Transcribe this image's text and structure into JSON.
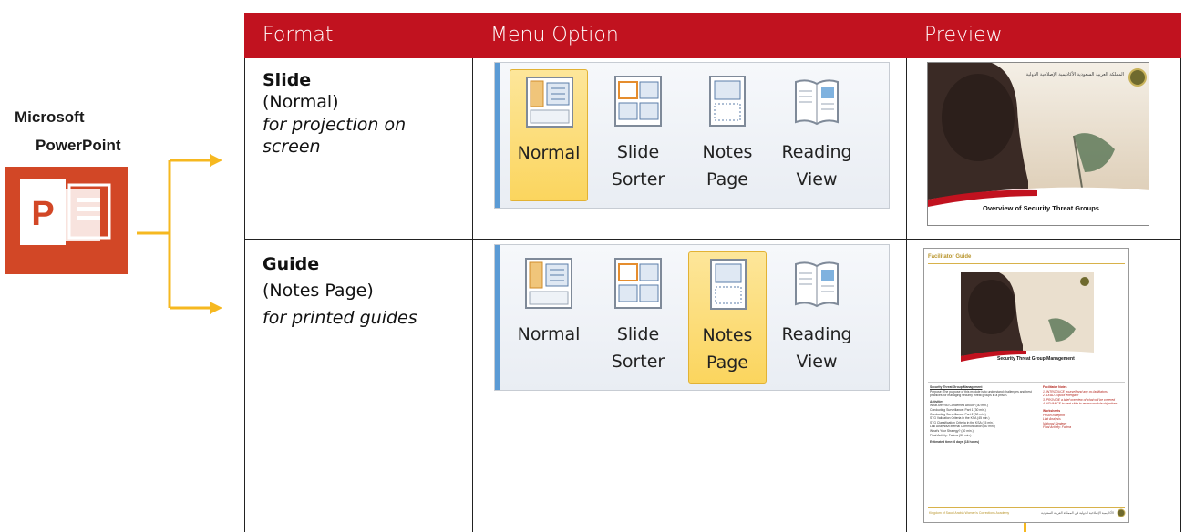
{
  "app": {
    "title_line1": "Microsoft",
    "title_line2": "PowerPoint",
    "icon": "powerpoint-icon",
    "icon_letter": "P",
    "brand_color": "#d24726"
  },
  "table": {
    "header_color": "#c1121f",
    "headers": [
      "Format",
      "Menu Option",
      "Preview"
    ],
    "rows": [
      {
        "format_title": "Slide",
        "format_mode": "(Normal)",
        "format_desc": "for projection on screen",
        "active_button": "Normal"
      },
      {
        "format_title": "Guide",
        "format_mode": "(Notes Page)",
        "format_desc": "for printed guides",
        "active_button": "Notes Page"
      }
    ]
  },
  "ribbon": {
    "buttons": [
      {
        "line1": "Normal",
        "line2": "",
        "icon": "normal-view-icon"
      },
      {
        "line1": "Slide",
        "line2": "Sorter",
        "icon": "slide-sorter-icon"
      },
      {
        "line1": "Notes",
        "line2": "Page",
        "icon": "notes-page-icon"
      },
      {
        "line1": "Reading",
        "line2": "View",
        "icon": "reading-view-icon"
      }
    ],
    "active_color": "#fbd55e"
  },
  "preview": {
    "slide_title": "Overview of Security Threat Groups",
    "slide_org": "المملكة العربية السعودية\nالأكاديمية الإصلاحية الدولية",
    "guide_header": "Facilitator Guide",
    "guide_slide_title": "Security Threat Group Management",
    "guide_left_heading": "Security Threat Group Management",
    "guide_purpose": "Purpose: The purpose of this module is to understand challenges and best practices for managing security threat groups in a prison.",
    "guide_activities_heading": "Activities",
    "guide_activities": [
      "What Are You Concerned About? (30 min.)",
      "Conducting Surveillance: Part 1 (30 min.)",
      "Conducting Surveillance: Part 2 (30 min.)",
      "STG Validation Criteria in the KSA (45 min.)",
      "STG Classification Criteria in the KSA (15 min.)",
      "Link Analysis/External Communication (30 min.)",
      "What's Your Strategy? (30 min.)",
      "Final Activity: Fatima (30 min.)"
    ],
    "guide_time": "Estimated time: 6 days (18 hours)",
    "guide_notes_heading": "Facilitator Notes",
    "guide_notes": [
      "1. INTRODUCE yourself and any co-facilitators",
      "2. LEAD a quick energizer",
      "3. PROVIDE a brief overview of what will be covered",
      "4. ADVANCE to next slide to review module objectives"
    ],
    "guide_worksheets_heading": "Worksheets",
    "guide_worksheets": [
      "Prison Blueprint",
      "Link Analysis",
      "National Strategy",
      "Final Activity: Fatima"
    ],
    "guide_footer_left": "Kingdom of Saudi Arabia Women's Corrections Academy",
    "guide_footer_right": "الأكاديمية الإصلاحية الدولية في المملكة العربية السعودية"
  }
}
